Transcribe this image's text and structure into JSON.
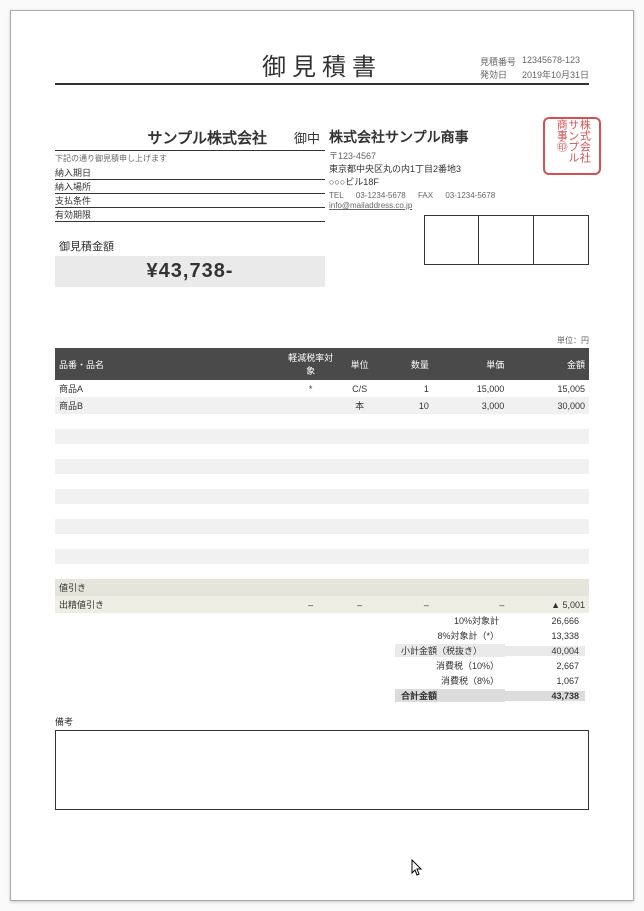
{
  "doc": {
    "title": "御見積書",
    "number_label": "見積番号",
    "number": "12345678-123",
    "date_label": "発効日",
    "date": "2019年10月31日"
  },
  "client": {
    "name": "サンプル株式会社",
    "honorific": "御中",
    "intro": "下記の通り御見積申し上げます"
  },
  "terms": {
    "delivery_date": "納入期日",
    "delivery_place": "納入場所",
    "payment": "支払条件",
    "validity": "有効期限"
  },
  "issuer": {
    "name": "株式会社サンプル商事",
    "postal": "〒123-4567",
    "addr1": "東京都中央区丸の内1丁目2番地3",
    "addr2": "○○○ビル18F",
    "tel_label": "TEL",
    "tel": "03-1234-5678",
    "fax_label": "FAX",
    "fax": "03-1234-5678",
    "email": "info@mailaddress.co.jp",
    "stamp_text": "株式会社\nサンプル\n商事㊞"
  },
  "total": {
    "label": "御見積金額",
    "amount": "¥43,738-"
  },
  "unit_note": "単位：円",
  "columns": {
    "name": "品番・品名",
    "tax": "軽減税率対象",
    "unit": "単位",
    "qty": "数量",
    "price": "単価",
    "amount": "金額"
  },
  "items": [
    {
      "name": "商品A",
      "tax": "*",
      "unit": "C/S",
      "qty": "1",
      "price": "15,000",
      "amount": "15,005"
    },
    {
      "name": "商品B",
      "tax": "",
      "unit": "本",
      "qty": "10",
      "price": "3,000",
      "amount": "30,000"
    },
    {
      "name": "",
      "tax": "",
      "unit": "",
      "qty": "",
      "price": "",
      "amount": ""
    },
    {
      "name": "",
      "tax": "",
      "unit": "",
      "qty": "",
      "price": "",
      "amount": ""
    },
    {
      "name": "",
      "tax": "",
      "unit": "",
      "qty": "",
      "price": "",
      "amount": ""
    },
    {
      "name": "",
      "tax": "",
      "unit": "",
      "qty": "",
      "price": "",
      "amount": ""
    },
    {
      "name": "",
      "tax": "",
      "unit": "",
      "qty": "",
      "price": "",
      "amount": ""
    },
    {
      "name": "",
      "tax": "",
      "unit": "",
      "qty": "",
      "price": "",
      "amount": ""
    },
    {
      "name": "",
      "tax": "",
      "unit": "",
      "qty": "",
      "price": "",
      "amount": ""
    },
    {
      "name": "",
      "tax": "",
      "unit": "",
      "qty": "",
      "price": "",
      "amount": ""
    },
    {
      "name": "",
      "tax": "",
      "unit": "",
      "qty": "",
      "price": "",
      "amount": ""
    },
    {
      "name": "",
      "tax": "",
      "unit": "",
      "qty": "",
      "price": "",
      "amount": ""
    },
    {
      "name": "",
      "tax": "",
      "unit": "",
      "qty": "",
      "price": "",
      "amount": ""
    }
  ],
  "discount": {
    "label": "値引き",
    "tax": "",
    "unit": "",
    "qty": "",
    "price": "",
    "amount": ""
  },
  "shipping": {
    "label": "出精値引き",
    "tax": "–",
    "unit": "–",
    "qty": "–",
    "price": "–",
    "amount": "▲ 5,001"
  },
  "summary": [
    {
      "k": "10%対象計",
      "v": "26,666",
      "cls": "indent"
    },
    {
      "k": "8%対象計（*）",
      "v": "13,338",
      "cls": "indent"
    },
    {
      "k": "小計金額（税抜き）",
      "v": "40,004",
      "cls": "sub"
    },
    {
      "k": "消費税（10%）",
      "v": "2,667",
      "cls": "indent"
    },
    {
      "k": "消費税（8%）",
      "v": "1,067",
      "cls": "indent"
    },
    {
      "k": "合計金額",
      "v": "43,738",
      "cls": "total"
    }
  ],
  "notes_label": "備考"
}
